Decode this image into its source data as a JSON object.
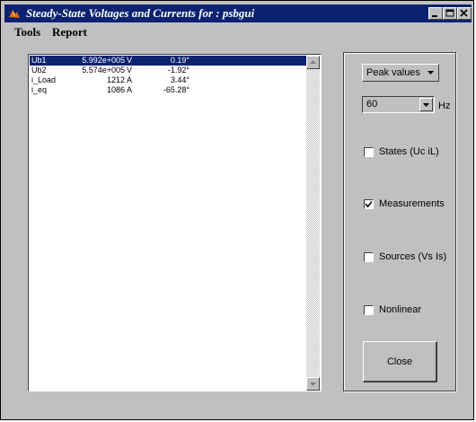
{
  "window": {
    "title": "Steady-State Voltages and Currents for : psbgui",
    "colors": {
      "titlebar": "#0a2270",
      "face": "#c0c0c0",
      "selection": "#0a2270"
    }
  },
  "menu": {
    "tools": "Tools",
    "report": "Report"
  },
  "list": {
    "rows": [
      {
        "name": "Ub1",
        "magnitude": "5.992e+005",
        "unit": "V",
        "angle": "0.19°",
        "selected": true
      },
      {
        "name": "Ub2",
        "magnitude": "5.574e+005",
        "unit": "V",
        "angle": "-1.92°",
        "selected": false
      },
      {
        "name": "i_Load",
        "magnitude": "1212",
        "unit": "A",
        "angle": "3.44°",
        "selected": false
      },
      {
        "name": "i_eq",
        "magnitude": "1086",
        "unit": "A",
        "angle": "-65.28°",
        "selected": false
      }
    ]
  },
  "controls": {
    "value_type": "Peak values",
    "frequency": "60",
    "frequency_unit": "Hz",
    "checkboxes": {
      "states": {
        "label": "States  (Uc iL)",
        "checked": false
      },
      "measurements": {
        "label": "Measurements",
        "checked": true
      },
      "sources": {
        "label": "Sources (Vs Is)",
        "checked": false
      },
      "nonlinear": {
        "label": "Nonlinear",
        "checked": false
      }
    },
    "close": "Close"
  }
}
